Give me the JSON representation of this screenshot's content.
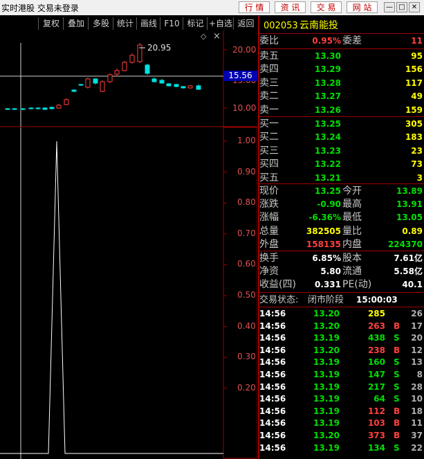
{
  "titlebar": {
    "title": "实时港股 交易未登录",
    "buttons": [
      "行 情",
      "资 讯",
      "交 易",
      "网 站"
    ],
    "window_controls": [
      "minimize-icon",
      "restore-icon",
      "close-icon"
    ]
  },
  "toolbar": {
    "items": [
      "复权",
      "叠加",
      "多股",
      "统计",
      "画线",
      "F10",
      "标记",
      "+自选",
      "返回"
    ]
  },
  "chart": {
    "price_axis": [
      "20.00",
      "15.00",
      "10.00"
    ],
    "current_price_tag": "15.56",
    "high_label": "20.95",
    "indicator_axis": [
      "1.00",
      "0.90",
      "0.80",
      "0.70",
      "0.60",
      "0.50",
      "0.40",
      "0.30",
      "0.20"
    ],
    "diamond_icon": "diamond-icon"
  },
  "quote": {
    "code": "002053",
    "name": "云南能投",
    "weibi_label": "委比",
    "weibi": "0.95%",
    "weicha_label": "委差",
    "weicha": "11",
    "asks": [
      {
        "label": "卖五",
        "price": "13.30",
        "vol": "95"
      },
      {
        "label": "卖四",
        "price": "13.29",
        "vol": "156"
      },
      {
        "label": "卖三",
        "price": "13.28",
        "vol": "117"
      },
      {
        "label": "卖二",
        "price": "13.27",
        "vol": "49"
      },
      {
        "label": "卖一",
        "price": "13.26",
        "vol": "159"
      }
    ],
    "bids": [
      {
        "label": "买一",
        "price": "13.25",
        "vol": "305"
      },
      {
        "label": "买二",
        "price": "13.24",
        "vol": "183"
      },
      {
        "label": "买三",
        "price": "13.23",
        "vol": "23"
      },
      {
        "label": "买四",
        "price": "13.22",
        "vol": "73"
      },
      {
        "label": "买五",
        "price": "13.21",
        "vol": "3"
      }
    ],
    "stats": [
      {
        "l1": "现价",
        "v1": "13.25",
        "c1": "g",
        "l2": "今开",
        "v2": "13.89",
        "c2": "g"
      },
      {
        "l1": "涨跌",
        "v1": "-0.90",
        "c1": "g",
        "l2": "最高",
        "v2": "13.91",
        "c2": "g"
      },
      {
        "l1": "涨幅",
        "v1": "-6.36%",
        "c1": "g",
        "l2": "最低",
        "v2": "13.05",
        "c2": "g"
      },
      {
        "l1": "总量",
        "v1": "382505",
        "c1": "y",
        "l2": "量比",
        "v2": "0.89",
        "c2": "y"
      },
      {
        "l1": "外盘",
        "v1": "158135",
        "c1": "r",
        "l2": "内盘",
        "v2": "224370",
        "c2": "g"
      }
    ],
    "finance": [
      {
        "l1": "换手",
        "v1": "6.85%",
        "l2": "股本",
        "v2": "7.61亿"
      },
      {
        "l1": "净资",
        "v1": "5.80",
        "l2": "流通",
        "v2": "5.58亿"
      },
      {
        "l1": "收益(四)",
        "v1": "0.331",
        "l2": "PE(动)",
        "v2": "40.1"
      }
    ],
    "status_label": "交易状态:",
    "status_value": "闭市阶段",
    "status_time": "15:00:03",
    "ticks": [
      {
        "time": "14:56",
        "price": "13.20",
        "vol": "285",
        "bs": "",
        "n": "26",
        "vc": "y"
      },
      {
        "time": "14:56",
        "price": "13.20",
        "vol": "263",
        "bs": "B",
        "n": "17",
        "vc": "r"
      },
      {
        "time": "14:56",
        "price": "13.19",
        "vol": "438",
        "bs": "S",
        "n": "20",
        "vc": "g"
      },
      {
        "time": "14:56",
        "price": "13.20",
        "vol": "238",
        "bs": "B",
        "n": "12",
        "vc": "r"
      },
      {
        "time": "14:56",
        "price": "13.19",
        "vol": "160",
        "bs": "S",
        "n": "13",
        "vc": "g"
      },
      {
        "time": "14:56",
        "price": "13.19",
        "vol": "147",
        "bs": "S",
        "n": "8",
        "vc": "g"
      },
      {
        "time": "14:56",
        "price": "13.19",
        "vol": "217",
        "bs": "S",
        "n": "28",
        "vc": "g"
      },
      {
        "time": "14:56",
        "price": "13.19",
        "vol": "64",
        "bs": "S",
        "n": "10",
        "vc": "g"
      },
      {
        "time": "14:56",
        "price": "13.19",
        "vol": "112",
        "bs": "B",
        "n": "18",
        "vc": "r"
      },
      {
        "time": "14:56",
        "price": "13.19",
        "vol": "103",
        "bs": "B",
        "n": "11",
        "vc": "r"
      },
      {
        "time": "14:56",
        "price": "13.20",
        "vol": "373",
        "bs": "B",
        "n": "37",
        "vc": "r"
      },
      {
        "time": "14:56",
        "price": "13.19",
        "vol": "134",
        "bs": "S",
        "n": "22",
        "vc": "g"
      }
    ]
  },
  "colors": {
    "up": "#ff4040",
    "down": "#00e000",
    "axis": "#a00000",
    "label": "#e05050"
  }
}
